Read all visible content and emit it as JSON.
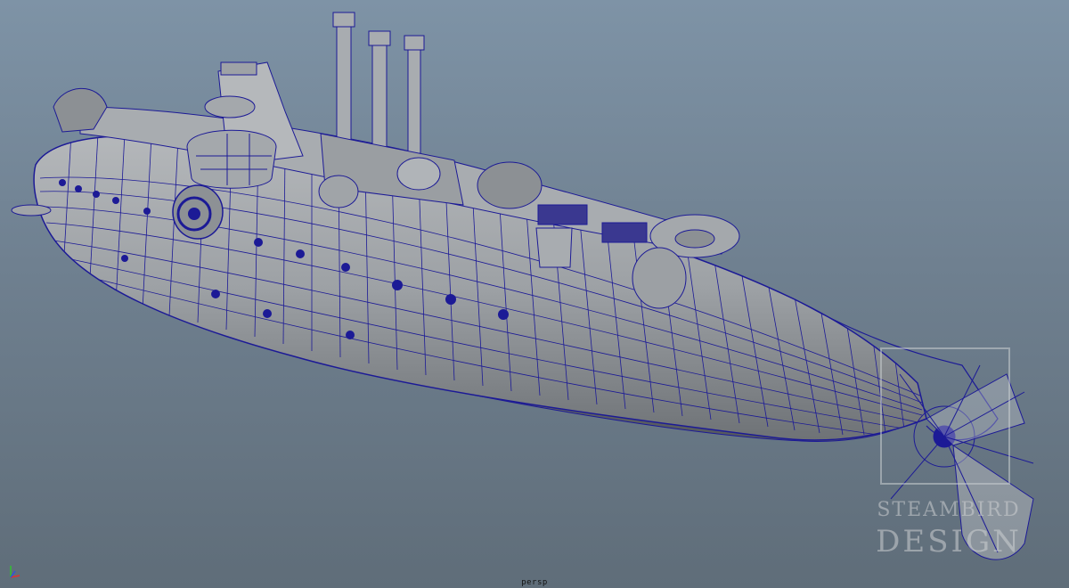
{
  "viewport": {
    "camera_label": "persp",
    "background_top": "#7e93a6",
    "background_bottom": "#5f6d79",
    "wireframe_color": "#1c1a96",
    "shaded_color": "#9a9ea2"
  },
  "watermark": {
    "line1": "STEAMBIRD",
    "line2": "DESIGN"
  },
  "axis_gizmo": {
    "x_color": "#e03030",
    "y_color": "#30c030",
    "z_color": "#3050e0"
  }
}
